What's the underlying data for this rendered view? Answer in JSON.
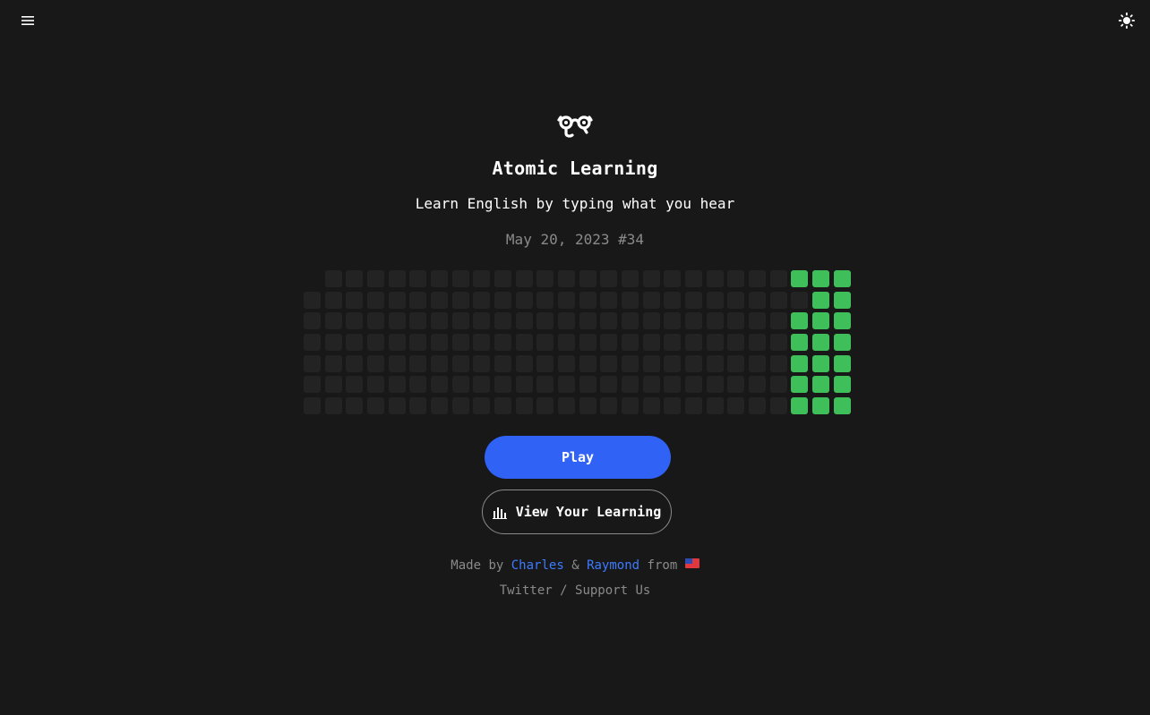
{
  "header": {
    "menu_icon": "hamburger-menu-icon",
    "theme_icon": "sun-icon"
  },
  "app": {
    "logo_icon": "atomic-logo-icon",
    "title": "Atomic Learning",
    "subtitle": "Learn English by typing what you hear",
    "date": "May 20, 2023",
    "issue": "#34"
  },
  "activity": {
    "columns": 26,
    "rows": 7,
    "empty_color": "#232323",
    "active_color": "#3fbf5a",
    "leading_blank_cells": 1,
    "active_cells": [
      [
        23,
        0
      ],
      [
        24,
        0
      ],
      [
        25,
        0
      ],
      [
        24,
        1
      ],
      [
        25,
        1
      ],
      [
        23,
        2
      ],
      [
        24,
        2
      ],
      [
        25,
        2
      ],
      [
        23,
        3
      ],
      [
        24,
        3
      ],
      [
        25,
        3
      ],
      [
        23,
        4
      ],
      [
        24,
        4
      ],
      [
        25,
        4
      ],
      [
        23,
        5
      ],
      [
        24,
        5
      ],
      [
        25,
        5
      ],
      [
        23,
        6
      ],
      [
        24,
        6
      ],
      [
        25,
        6
      ]
    ]
  },
  "actions": {
    "play_label": "Play",
    "view_learning_label": "View Your Learning",
    "view_learning_icon": "bar-chart-icon",
    "play_color": "#2f62f5"
  },
  "footer": {
    "made_by": "Made by",
    "author1": "Charles",
    "amp": "&",
    "author2": "Raymond",
    "from": "from",
    "flag_icon": "taiwan-flag-icon",
    "twitter": "Twitter",
    "separator": "/",
    "support": "Support Us",
    "link_color": "#3d7bff"
  }
}
